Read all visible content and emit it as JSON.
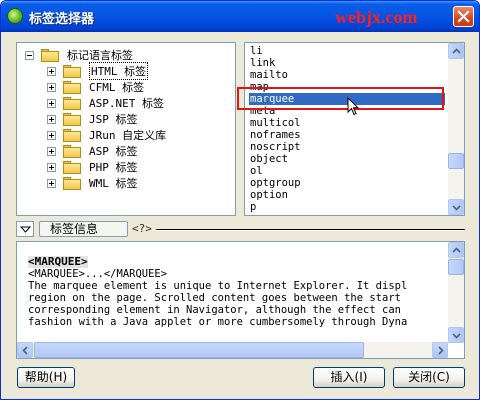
{
  "window": {
    "title": "标签选择器",
    "watermark": "webjx.com"
  },
  "tree": {
    "root_label": "标记语言标签",
    "items": [
      {
        "label": "HTML 标签",
        "selected": true
      },
      {
        "label": "CFML 标签"
      },
      {
        "label": "ASP.NET 标签"
      },
      {
        "label": "JSP 标签"
      },
      {
        "label": "JRun 自定义库"
      },
      {
        "label": "ASP 标签"
      },
      {
        "label": "PHP 标签"
      },
      {
        "label": "WML 标签"
      }
    ]
  },
  "tag_list": {
    "items": [
      "li",
      "link",
      "mailto",
      "map",
      "marquee",
      "meta",
      "multicol",
      "noframes",
      "noscript",
      "object",
      "ol",
      "optgroup",
      "option",
      "p"
    ],
    "selected": "marquee"
  },
  "info": {
    "label": "标签信息",
    "code_icon": "<?>"
  },
  "content": {
    "heading": "<MARQUEE>",
    "syntax": "<MARQUEE>...</MARQUEE>",
    "lines": [
      "The marquee element is unique to Internet Explorer. It displ",
      "region on the page. Scrolled content goes between the start",
      "corresponding element in Navigator, although the effect can",
      "fashion with a Java applet or more cumbersomely through Dyna"
    ]
  },
  "buttons": {
    "help": "帮助(H)",
    "insert": "插入(I)",
    "close": "关闭(C)"
  },
  "colors": {
    "title_bar": "#0554e3",
    "selection": "#316ac5",
    "annotation_box": "#e21414",
    "watermark": "#ff1e1e"
  },
  "icons": {
    "app": "dreamweaver-icon",
    "folder": "folder-icon",
    "close": "close-icon"
  }
}
